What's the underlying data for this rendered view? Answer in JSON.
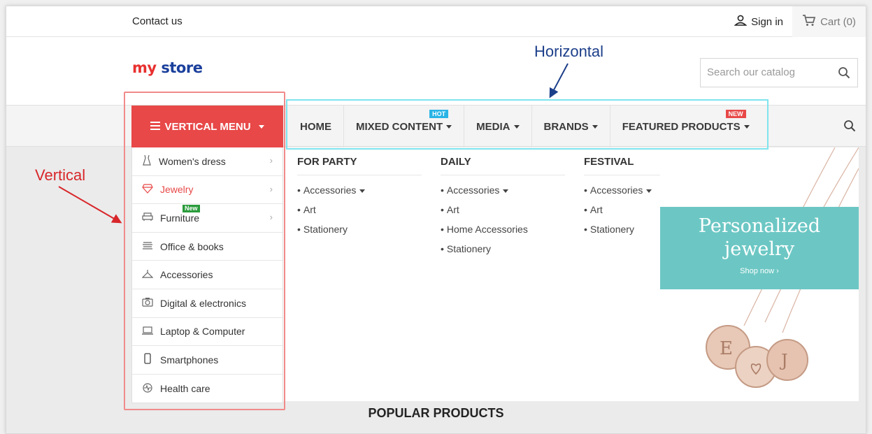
{
  "topbar": {
    "contact": "Contact us",
    "signin": "Sign in",
    "cart": "Cart (0)"
  },
  "header": {
    "logo_part1": "my",
    "logo_part2": "store",
    "search_placeholder": "Search our catalog"
  },
  "vertical_menu": {
    "button_label": "VERTICAL MENU",
    "items": [
      {
        "label": "Women's dress",
        "icon": "dress-icon",
        "has_submenu": true
      },
      {
        "label": "Jewelry",
        "icon": "diamond-icon",
        "has_submenu": true,
        "active": true
      },
      {
        "label": "Furniture",
        "icon": "armchair-icon",
        "has_submenu": true,
        "badge": "New"
      },
      {
        "label": "Office & books",
        "icon": "books-icon"
      },
      {
        "label": "Accessories",
        "icon": "accessories-icon"
      },
      {
        "label": "Digital & electronics",
        "icon": "camera-icon"
      },
      {
        "label": "Laptop & Computer",
        "icon": "laptop-icon"
      },
      {
        "label": "Smartphones",
        "icon": "smartphone-icon"
      },
      {
        "label": "Health care",
        "icon": "heartbeat-icon"
      }
    ]
  },
  "horizontal_menu": {
    "items": [
      {
        "label": "HOME"
      },
      {
        "label": "MIXED CONTENT",
        "dropdown": true,
        "badge": "HOT"
      },
      {
        "label": "MEDIA",
        "dropdown": true
      },
      {
        "label": "BRANDS",
        "dropdown": true
      },
      {
        "label": "FEATURED PRODUCTS",
        "dropdown": true,
        "badge": "NEW"
      }
    ]
  },
  "submenu": {
    "columns": [
      {
        "title": "FOR PARTY",
        "items": [
          "Accessories",
          "Art",
          "Stationery"
        ],
        "dropdown_first": true
      },
      {
        "title": "DAILY",
        "items": [
          "Accessories",
          "Art",
          "Home Accessories",
          "Stationery"
        ],
        "dropdown_first": true
      },
      {
        "title": "FESTIVAL",
        "items": [
          "Accessories",
          "Art",
          "Stationery"
        ],
        "dropdown_first": true
      }
    ]
  },
  "banner": {
    "title_line1": "Personalized",
    "title_line2": "jewelry",
    "cta": "Shop now ›"
  },
  "section_title": "POPULAR PRODUCTS",
  "annotations": {
    "vertical": "Vertical",
    "horizontal": "Horizontal"
  },
  "colors": {
    "accent_red": "#e84848",
    "hot_badge": "#2ab4e6",
    "new_badge_green": "#2a9b3c",
    "annotation_red": "#d8262a",
    "annotation_blue": "#1c3f8a",
    "highlight_cyan": "#7fe4ee",
    "banner_teal": "#6cc7c4"
  }
}
